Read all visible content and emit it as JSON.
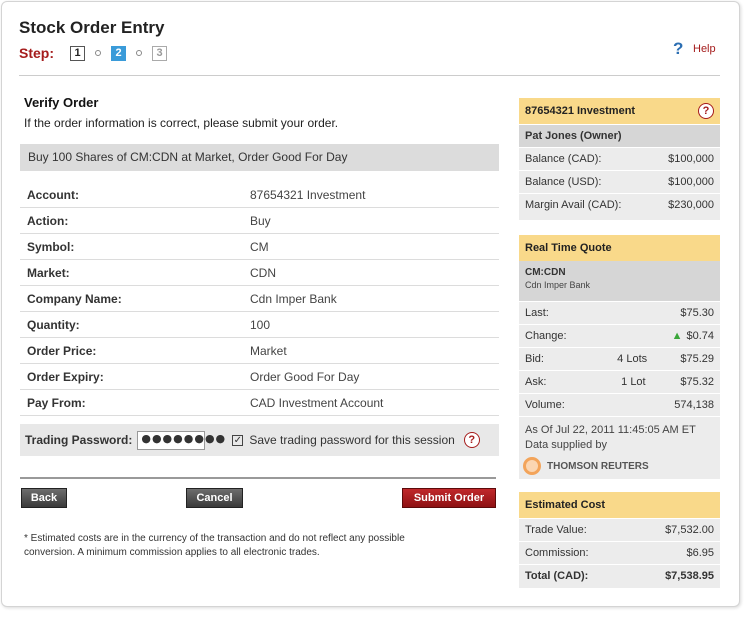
{
  "header": {
    "title": "Stock Order Entry",
    "step_label": "Step:",
    "steps": [
      "1",
      "2",
      "3"
    ],
    "help_label": "Help"
  },
  "verify": {
    "heading": "Verify Order",
    "subtitle": "If the order information is correct, please submit your order.",
    "summary": "Buy 100 Shares of CM:CDN  at Market, Order Good For Day",
    "rows": [
      {
        "label": "Account:",
        "value": "87654321 Investment"
      },
      {
        "label": "Action:",
        "value": "Buy"
      },
      {
        "label": "Symbol:",
        "value": "CM"
      },
      {
        "label": "Market:",
        "value": "CDN"
      },
      {
        "label": "Company Name:",
        "value": "Cdn Imper Bank"
      },
      {
        "label": "Quantity:",
        "value": "100"
      },
      {
        "label": "Order Price:",
        "value": "Market"
      },
      {
        "label": "Order Expiry:",
        "value": "Order Good For Day"
      },
      {
        "label": "Pay From:",
        "value": "CAD Investment Account"
      }
    ],
    "password_label": "Trading Password:",
    "password_value": "●●●●●●●●",
    "save_password_label": "Save trading password for this session",
    "save_password_checked": "✓"
  },
  "buttons": {
    "back": "Back",
    "cancel": "Cancel",
    "submit": "Submit Order"
  },
  "footnote": "* Estimated costs are in the currency of the transaction and do not reflect any possible conversion. A minimum commission applies to all electronic trades.",
  "account_panel": {
    "title": "87654321 Investment",
    "owner": "Pat Jones (Owner)",
    "rows": [
      {
        "label": "Balance (CAD):",
        "value": "$100,000"
      },
      {
        "label": "Balance (USD):",
        "value": "$100,000"
      },
      {
        "label": "Margin Avail (CAD):",
        "value": "$230,000"
      }
    ]
  },
  "quote_panel": {
    "title": "Real Time Quote",
    "symbol": "CM:CDN",
    "company": "Cdn Imper Bank",
    "last_label": "Last:",
    "last_value": "$75.30",
    "change_label": "Change:",
    "change_value": "$0.74",
    "bid_label": "Bid:",
    "bid_lots": "4 Lots",
    "bid_value": "$75.29",
    "ask_label": "Ask:",
    "ask_lots": "1 Lot",
    "ask_value": "$75.32",
    "volume_label": "Volume:",
    "volume_value": "574,138",
    "as_of": "As Of Jul 22, 2011 11:45:05 AM ET",
    "supplied_by": "Data supplied by",
    "provider": "THOMSON REUTERS"
  },
  "cost_panel": {
    "title": "Estimated Cost",
    "trade_value_label": "Trade Value:",
    "trade_value": "$7,532.00",
    "commission_label": "Commission:",
    "commission": "$6.95",
    "total_label": "Total (CAD):",
    "total": "$7,538.95"
  },
  "colors": {
    "accent_red": "#a51c1c",
    "panel_header": "#f9d98a",
    "step_active": "#3a9bd9"
  }
}
